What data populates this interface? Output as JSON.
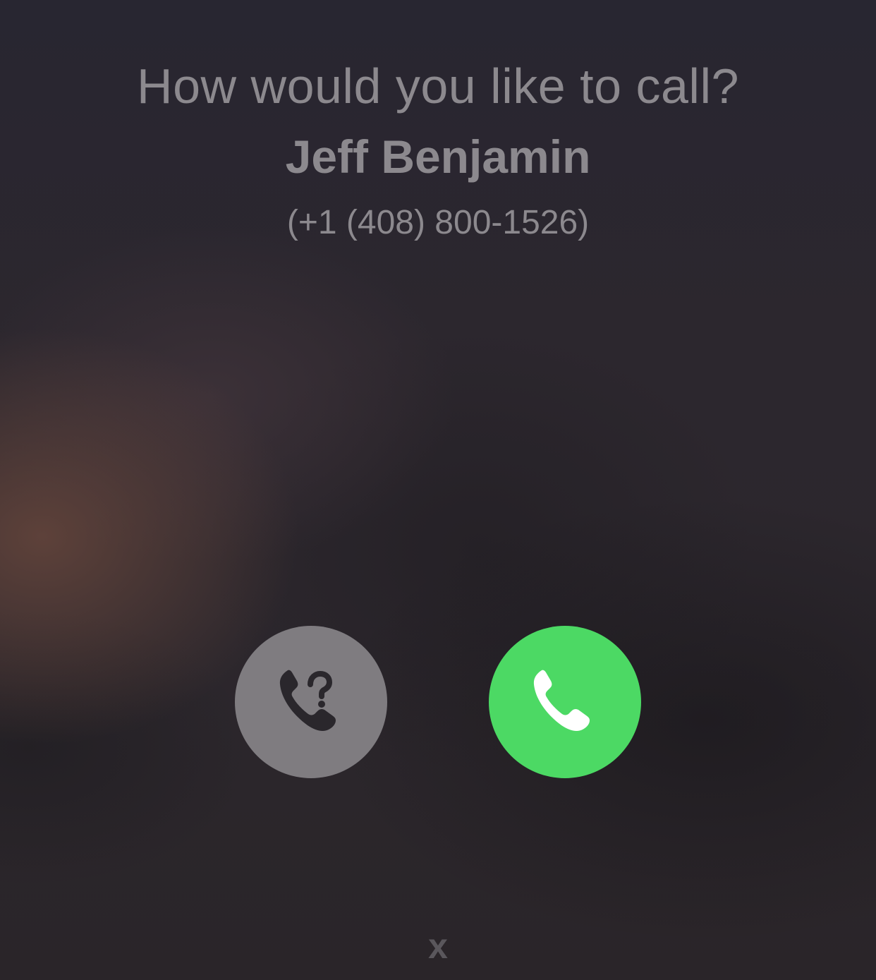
{
  "dialog": {
    "prompt": "How would you like to call?",
    "contact_name": "Jeff Benjamin",
    "phone_number": "(+1 (408) 800-1526)"
  },
  "actions": {
    "unknown_call_icon": "phone-question-icon",
    "regular_call_icon": "phone-icon",
    "unknown_call_color": "#7f7c80",
    "regular_call_color": "#4cd964"
  },
  "close": {
    "label": "x"
  }
}
